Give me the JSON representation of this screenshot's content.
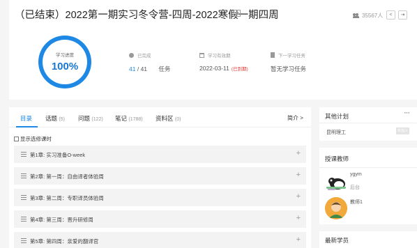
{
  "course": {
    "title": "（已结束）2022第一期实习冬令营-四周-2022寒假一期四周",
    "student_count": "35567人"
  },
  "progress": {
    "label": "学习进度",
    "value": "100%",
    "fraction": 1.0
  },
  "stats": {
    "completed": {
      "label": "已完成",
      "done": "41",
      "separator": " / ",
      "total": "41",
      "unit": "任务"
    },
    "validity": {
      "label": "学习有效期",
      "date": "2022-03-11",
      "status": "(已到期)"
    },
    "next_task": {
      "label": "下一学习任务",
      "value": "暂无学习任务"
    }
  },
  "tabs": [
    {
      "label": "目录",
      "count": ""
    },
    {
      "label": "话题",
      "count": "(5)"
    },
    {
      "label": "问题",
      "count": "(122)"
    },
    {
      "label": "笔记",
      "count": "(1788)"
    },
    {
      "label": "资料区",
      "count": "(0)"
    }
  ],
  "brief_link": "简介 >",
  "show_optional_label": "显示选修课时",
  "chapters": [
    "第1章: 实习准备O-week",
    "第2章: 第一周：自由译者体验周",
    "第3章: 第二周：专职译员体验周",
    "第4章: 第三周：晋升研修周",
    "第5章: 第四周：亲爱的翻译官"
  ],
  "sidebar": {
    "other_plans": {
      "title": "其他计划",
      "more": "···",
      "plan_name": "昆明理工",
      "badge": "未加入"
    },
    "teachers": {
      "title": "授课教师",
      "list": [
        {
          "name": "ygym",
          "sub": "后台"
        },
        {
          "name": "教师1",
          "sub": ""
        }
      ]
    },
    "new_students": {
      "title": "最新学员"
    }
  },
  "colors": {
    "accent": "#1e88e5",
    "expired": "#e53935"
  }
}
